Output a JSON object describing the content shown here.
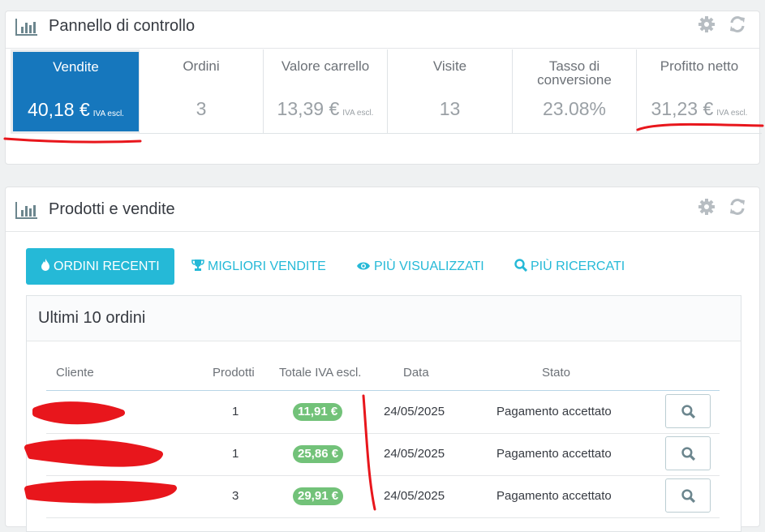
{
  "dashboard": {
    "title": "Pannello di controllo",
    "icons": {
      "heading": "bar-chart-icon",
      "config": "gear-icon",
      "refresh": "refresh-icon"
    },
    "kpis": [
      {
        "title": "Vendite",
        "value": "40,18 €",
        "suffix": "IVA escl."
      },
      {
        "title": "Ordini",
        "value": "3",
        "suffix": ""
      },
      {
        "title": "Valore carrello",
        "value": "13,39 €",
        "suffix": "IVA escl."
      },
      {
        "title": "Visite",
        "value": "13",
        "suffix": ""
      },
      {
        "title": "Tasso di conversione",
        "value": "23.08%",
        "suffix": ""
      },
      {
        "title": "Profitto netto",
        "value": "31,23 €",
        "suffix": "IVA escl."
      }
    ]
  },
  "products": {
    "title": "Prodotti e vendite",
    "tabs": [
      {
        "label": "ORDINI RECENTI",
        "icon": "fire-icon"
      },
      {
        "label": "MIGLIORI VENDITE",
        "icon": "trophy-icon"
      },
      {
        "label": "PIÙ VISUALIZZATI",
        "icon": "eye-icon"
      },
      {
        "label": "PIÙ RICERCATI",
        "icon": "search-icon"
      }
    ],
    "box_title": "Ultimi 10 ordini",
    "columns": [
      "Cliente",
      "Prodotti",
      "Totale IVA escl.",
      "Data",
      "Stato"
    ],
    "rows": [
      {
        "customer": "",
        "products": "1",
        "total": "11,91 €",
        "date": "24/05/2025",
        "status": "Pagamento accettato"
      },
      {
        "customer": "",
        "products": "1",
        "total": "25,86 €",
        "date": "24/05/2025",
        "status": "Pagamento accettato"
      },
      {
        "customer": "",
        "products": "3",
        "total": "29,91 €",
        "date": "24/05/2025",
        "status": "Pagamento accettato"
      }
    ]
  },
  "colors": {
    "primary": "#1677bd",
    "accent": "#25b9d7",
    "success_badge": "#72c279",
    "annotation": "#e8161c"
  }
}
